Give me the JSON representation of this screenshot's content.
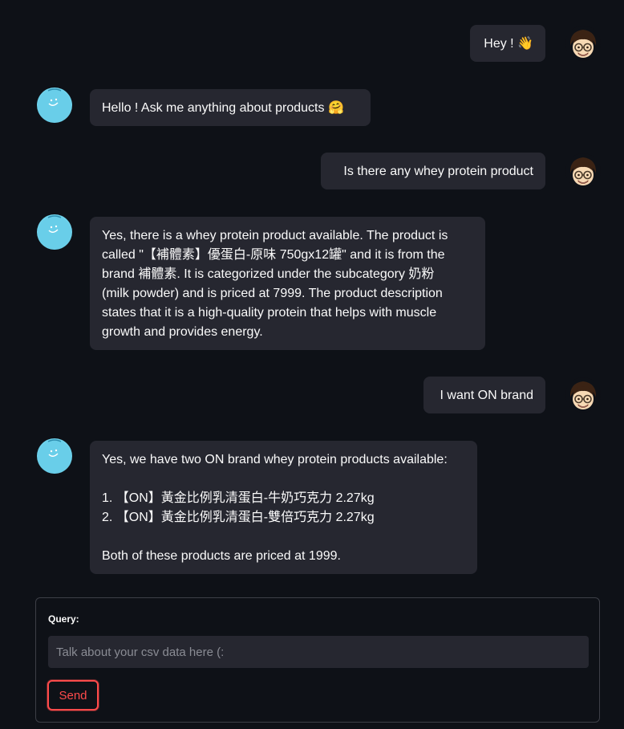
{
  "messages": [
    {
      "role": "user",
      "text": "Hey ! 👋"
    },
    {
      "role": "assistant",
      "text": "Hello ! Ask me anything about products 🤗"
    },
    {
      "role": "user",
      "text": "Is there any whey protein product"
    },
    {
      "role": "assistant",
      "text": "Yes, there is a whey protein product available. The product is\ncalled \"【補體素】優蛋白-原味 750gx12罐\" and it is from the\nbrand 補體素. It is categorized under the subcategory 奶粉\n(milk powder) and is priced at 7999. The product description\nstates that it is a high-quality protein that helps with muscle\ngrowth and provides energy."
    },
    {
      "role": "user",
      "text": "I want ON brand"
    },
    {
      "role": "assistant",
      "text": "Yes, we have two ON brand whey protein products available:\n\n1. 【ON】黃金比例乳清蛋白-牛奶巧克力 2.27kg\n2. 【ON】黃金比例乳清蛋白-雙倍巧克力 2.27kg\n\nBoth of these products are priced at 1999."
    }
  ],
  "avatars": {
    "user_icon": "girl-with-glasses-avatar-icon",
    "assistant_icon": "smiling-blue-circle-avatar-icon"
  },
  "form": {
    "label": "Query:",
    "placeholder": "Talk about your csv data here (:",
    "value": "",
    "send_label": "Send"
  },
  "colors": {
    "background": "#0e1117",
    "bubble": "#262730",
    "accent": "#ff4b4b",
    "assistant_avatar": "#6fd3ec"
  }
}
